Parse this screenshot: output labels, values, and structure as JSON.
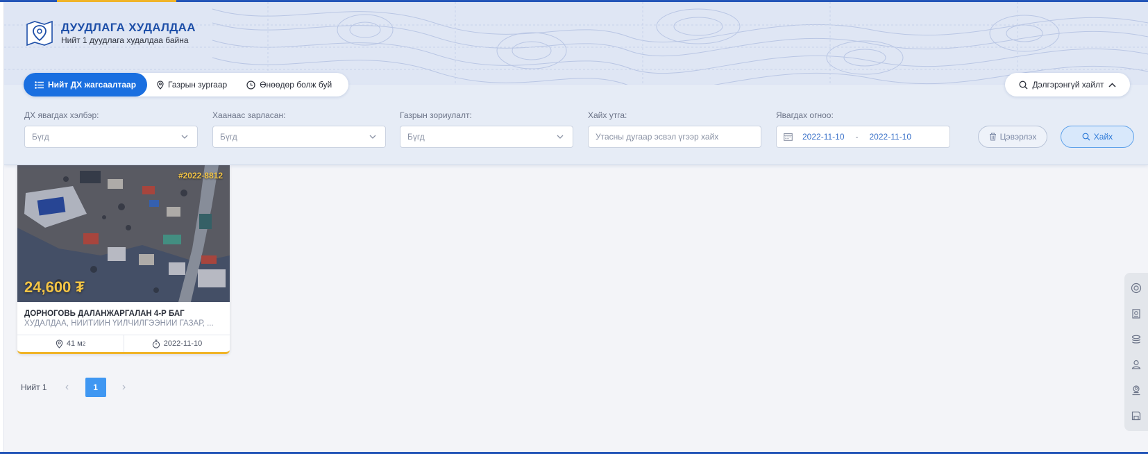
{
  "header": {
    "title": "ДУУДЛАГА ХУДАЛДАА",
    "subtitle": "Нийт 1 дуудлага худалдаа байна"
  },
  "tabs": [
    {
      "label": "Нийт ДХ жагсаалтаар",
      "icon": "list-icon",
      "active": true
    },
    {
      "label": "Газрын зургаар",
      "icon": "map-pin-icon",
      "active": false
    },
    {
      "label": "Өнөөдөр болж буй",
      "icon": "clock-icon",
      "active": false
    }
  ],
  "advanced_search": {
    "label": "Дэлгэрэнгүй хайлт",
    "icon": "chevron-up-icon"
  },
  "filters": {
    "type": {
      "label": "ДХ явагдах хэлбэр:",
      "value": "Бүгд"
    },
    "source": {
      "label": "Хаанаас зарласан:",
      "value": "Бүгд"
    },
    "purpose": {
      "label": "Газрын зориулалт:",
      "value": "Бүгд"
    },
    "keyword": {
      "label": "Хайх утга:",
      "placeholder": "Утасны дугаар эсвэл үгээр хайх"
    },
    "date": {
      "label": "Явагдах огноо:",
      "from": "2022-11-10",
      "separator": "-",
      "to": "2022-11-10"
    },
    "clear_label": "Цэвэрлэх",
    "search_label": "Хайх"
  },
  "listings": [
    {
      "id": "#2022-8812",
      "price": "24,600 ₮",
      "title": "ДОРНОГОВЬ ДАЛАНЖАРГАЛАН 4-Р БАГ",
      "subtitle": "ХУДАЛДАА, НИЙТИЙН ҮЙЛЧИЛГЭЭНИЙ ГАЗАР, ...",
      "area": "41 м",
      "area_sup": "2",
      "date": "2022-11-10"
    }
  ],
  "pagination": {
    "total": "Нийт 1",
    "current": "1",
    "prev": "‹",
    "next": "›"
  },
  "colors": {
    "primary": "#1a6fe0",
    "accent": "#f0b429",
    "brand": "#1e4fa8"
  }
}
